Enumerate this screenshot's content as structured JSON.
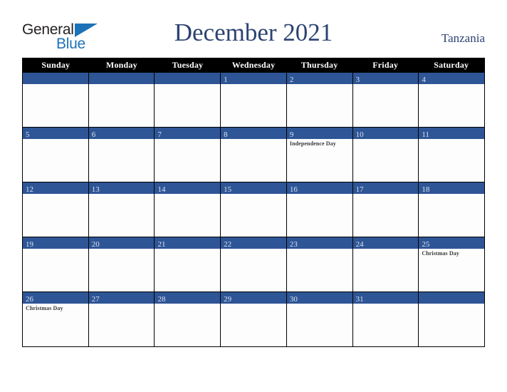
{
  "brand": {
    "name_part1": "General",
    "name_part2": "Blue",
    "triangle_icon": "blue-triangle-icon",
    "color_dark": "#231f20",
    "color_blue": "#1c72b8"
  },
  "header": {
    "title": "December 2021",
    "country": "Tanzania",
    "title_color": "#2c4372"
  },
  "calendar": {
    "month": "December",
    "year": "2021",
    "accent_color": "#2e5596",
    "header_bg": "#000000",
    "weekdays": [
      "Sunday",
      "Monday",
      "Tuesday",
      "Wednesday",
      "Thursday",
      "Friday",
      "Saturday"
    ],
    "weeks": [
      [
        {
          "day": "",
          "events": []
        },
        {
          "day": "",
          "events": []
        },
        {
          "day": "",
          "events": []
        },
        {
          "day": "1",
          "events": []
        },
        {
          "day": "2",
          "events": []
        },
        {
          "day": "3",
          "events": []
        },
        {
          "day": "4",
          "events": []
        }
      ],
      [
        {
          "day": "5",
          "events": []
        },
        {
          "day": "6",
          "events": []
        },
        {
          "day": "7",
          "events": []
        },
        {
          "day": "8",
          "events": []
        },
        {
          "day": "9",
          "events": [
            "Independence Day"
          ]
        },
        {
          "day": "10",
          "events": []
        },
        {
          "day": "11",
          "events": []
        }
      ],
      [
        {
          "day": "12",
          "events": []
        },
        {
          "day": "13",
          "events": []
        },
        {
          "day": "14",
          "events": []
        },
        {
          "day": "15",
          "events": []
        },
        {
          "day": "16",
          "events": []
        },
        {
          "day": "17",
          "events": []
        },
        {
          "day": "18",
          "events": []
        }
      ],
      [
        {
          "day": "19",
          "events": []
        },
        {
          "day": "20",
          "events": []
        },
        {
          "day": "21",
          "events": []
        },
        {
          "day": "22",
          "events": []
        },
        {
          "day": "23",
          "events": []
        },
        {
          "day": "24",
          "events": []
        },
        {
          "day": "25",
          "events": [
            "Christmas Day"
          ]
        }
      ],
      [
        {
          "day": "26",
          "events": [
            "Christmas Day"
          ]
        },
        {
          "day": "27",
          "events": []
        },
        {
          "day": "28",
          "events": []
        },
        {
          "day": "29",
          "events": []
        },
        {
          "day": "30",
          "events": []
        },
        {
          "day": "31",
          "events": []
        },
        {
          "day": "",
          "events": []
        }
      ]
    ]
  }
}
